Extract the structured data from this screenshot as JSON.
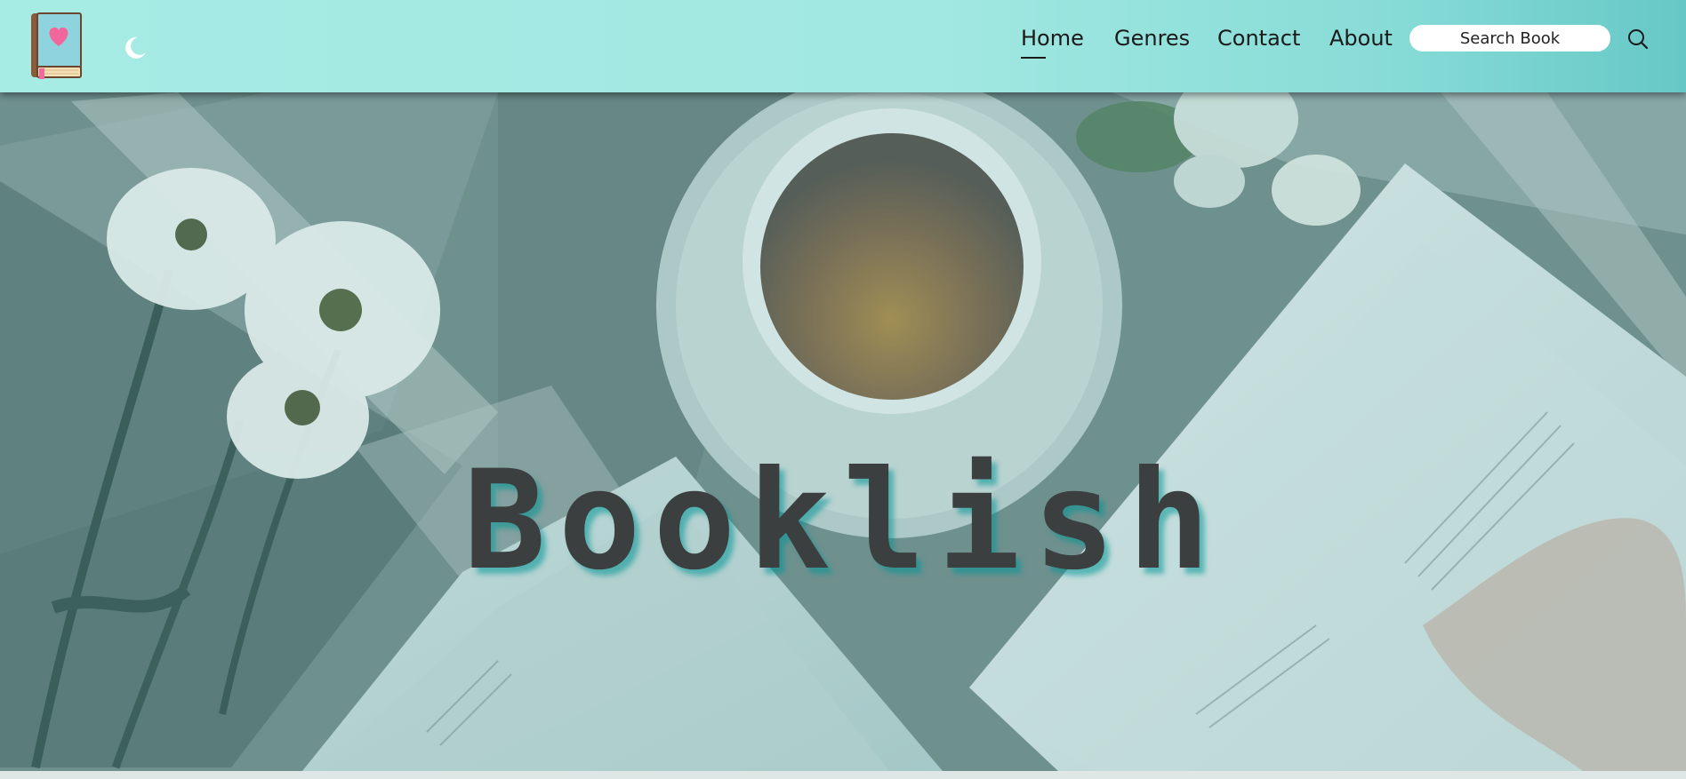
{
  "header": {
    "logo_icon": "book-heart-icon",
    "theme_toggle_icon": "moon-icon",
    "nav": [
      {
        "label": "Home",
        "active": true
      },
      {
        "label": "Genres",
        "active": false
      },
      {
        "label": "Contact",
        "active": false
      },
      {
        "label": "About",
        "active": false
      }
    ],
    "search": {
      "placeholder": "Search Book",
      "value": ""
    },
    "search_icon": "search-icon"
  },
  "hero": {
    "title": "Booklish",
    "background": "coffee-cup-flowers-open-books-photo"
  },
  "colors": {
    "header_bg": "#a2e8e2",
    "header_bg_end": "#66c8c6",
    "title_color": "#3b3f40",
    "title_shadow": "#009696"
  }
}
